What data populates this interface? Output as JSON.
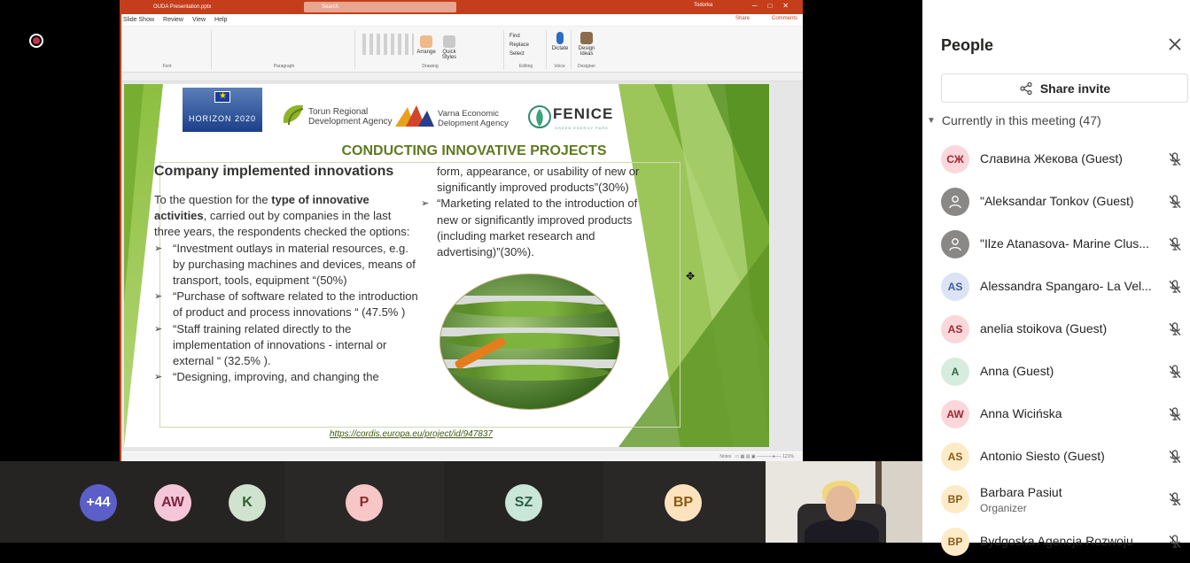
{
  "app": {
    "recording_indicator": "recording"
  },
  "powerpoint": {
    "document_name": "OUDA Presentation.pptx",
    "search_placeholder": "Search",
    "user_name": "Todorka",
    "menu": [
      "Slide Show",
      "Review",
      "View",
      "Help"
    ],
    "share_label": "Share",
    "comments_label": "Comments",
    "ribbon_groups": [
      "Font",
      "Paragraph",
      "Drawing",
      "Editing",
      "Voice",
      "Designer"
    ],
    "ribbon_tools": {
      "find": "Find",
      "replace": "Replace",
      "select": "Select",
      "dictate": "Dictate",
      "design_ideas": "Design Ideas",
      "arrange": "Arrange",
      "quick_styles": "Quick Styles"
    },
    "status_notes": "Notes",
    "status_zoom": "121%"
  },
  "slide": {
    "logos": {
      "eu": "HORIZON 2020",
      "torun": "Torun Regional\nDevelopment Agency",
      "varna": "Varna Economic\nDelopment Agency",
      "fenice": "FENICE",
      "fenice_sub": "GREEN ENERGY PARK"
    },
    "title": "CONDUCTING INNOVATIVE PROJECTS",
    "subheading": "Company implemented innovations",
    "intro_pre": "To the question  for the ",
    "intro_bold": "type of innovative activities",
    "intro_post": ",  carried out by companies in the last three years, the respondents  checked the options:",
    "left_bullets": [
      "“Investment outlays in material resources, e.g. by purchasing machines and devices, means of transport, tools, equipment “(50%)",
      " “Purchase of software related to the introduction of product and process innovations “ (47.5% )",
      " “Staff training related directly to the implementation of innovations - internal or external “  (32.5% ).",
      "“Designing, improving, and changing the"
    ],
    "right_continuation": "form, appearance, or usability of new or significantly improved products”(30%)",
    "right_bullets": [
      "“Marketing related to the introduction of new or significantly improved products (including market research and advertising)”(30%)."
    ],
    "source_link": "https://cordis.europa.eu/project/id/947837"
  },
  "participant_bar": {
    "tiles": [
      {
        "initials": "+44",
        "color": "#5b5fc7",
        "text_color": "#ffffff"
      },
      {
        "initials": "AW",
        "color": "#f5c6d8",
        "text_color": "#7a2540"
      },
      {
        "initials": "K",
        "color": "#cfe3cf",
        "text_color": "#2f5d2f"
      },
      {
        "initials": "P",
        "color": "#f7c6c6",
        "text_color": "#8a2b2b"
      },
      {
        "initials": "SZ",
        "color": "#c9e6d8",
        "text_color": "#2d5e47"
      },
      {
        "initials": "BP",
        "color": "#fde3bd",
        "text_color": "#8a5a12"
      }
    ]
  },
  "people_panel": {
    "title": "People",
    "share_invite_label": "Share invite",
    "section_label": "Currently in this meeting (47)",
    "participants": [
      {
        "initials": "СЖ",
        "name": "Славина Жекова (Guest)",
        "role": "",
        "avatar_bg": "#fbd7dc",
        "avatar_fg": "#a4262c",
        "icon": "mic-off-icon"
      },
      {
        "initials": "",
        "name": "\"Aleksandar Tonkov (Guest)",
        "role": "",
        "avatar_bg": "#8a8886",
        "avatar_fg": "#ffffff",
        "icon": "mic-off-icon"
      },
      {
        "initials": "",
        "name": "\"Ilze Atanasova- Marine Clus...",
        "role": "",
        "avatar_bg": "#8a8886",
        "avatar_fg": "#ffffff",
        "icon": "mic-off-icon"
      },
      {
        "initials": "AS",
        "name": "Alessandra Spangaro- La Vel...",
        "role": "",
        "avatar_bg": "#dbe3f4",
        "avatar_fg": "#3e5b9a",
        "icon": "mic-off-icon"
      },
      {
        "initials": "AS",
        "name": "anelia stoikova (Guest)",
        "role": "",
        "avatar_bg": "#fbd7dc",
        "avatar_fg": "#a4262c",
        "icon": "mic-off-icon"
      },
      {
        "initials": "A",
        "name": "Anna (Guest)",
        "role": "",
        "avatar_bg": "#d6ecdc",
        "avatar_fg": "#2b6a3c",
        "icon": "mic-off-icon"
      },
      {
        "initials": "AW",
        "name": "Anna Wicińska",
        "role": "",
        "avatar_bg": "#fbd7dc",
        "avatar_fg": "#a4262c",
        "icon": "mic-off-icon"
      },
      {
        "initials": "AS",
        "name": "Antonio Siesto (Guest)",
        "role": "",
        "avatar_bg": "#fdebc8",
        "avatar_fg": "#8a5a12",
        "icon": "mic-off-icon"
      },
      {
        "initials": "BP",
        "name": "Barbara Pasiut",
        "role": "Organizer",
        "avatar_bg": "#fdebc8",
        "avatar_fg": "#8a5a12",
        "icon": "mic-off-icon"
      },
      {
        "initials": "BP",
        "name": "Bydgoska Agencja Rozwoju",
        "role": "",
        "avatar_bg": "#fdebc8",
        "avatar_fg": "#8a5a12",
        "icon": "mic-off-icon"
      }
    ]
  }
}
